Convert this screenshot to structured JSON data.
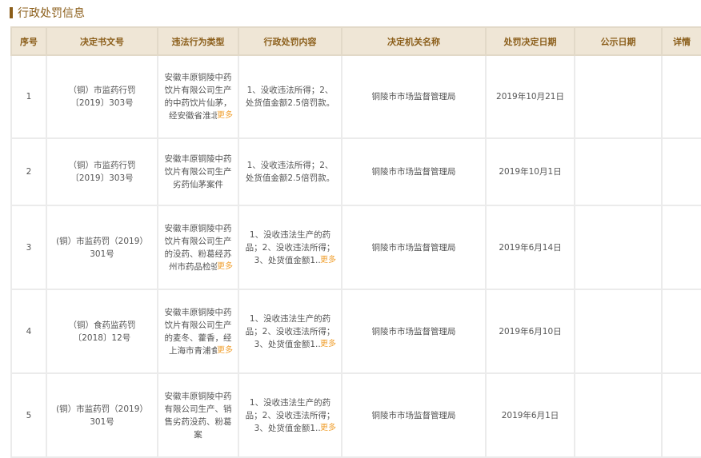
{
  "section": {
    "title": "行政处罚信息"
  },
  "table": {
    "headers": [
      "序号",
      "决定书文号",
      "违法行为类型",
      "行政处罚内容",
      "决定机关名称",
      "处罚决定日期",
      "公示日期",
      "详情"
    ],
    "more_label": "更多",
    "rows": [
      {
        "index": "1",
        "doc_no": "（铜）市监药行罚〔2019〕303号",
        "violation": "安徽丰原铜陵中药饮片有限公司生产的中药饮片仙茅，经安徽省淮北...",
        "has_violation_more": true,
        "content": "1、没收违法所得；2、处货值金额2.5倍罚款。",
        "has_content_more": false,
        "authority": "铜陵市市场监督管理局",
        "decision_date": "2019年10月21日",
        "publish_date": "",
        "detail": ""
      },
      {
        "index": "2",
        "doc_no": "（铜）市监药行罚〔2019〕303号",
        "violation": "安徽丰原铜陵中药饮片有限公司生产劣药仙茅案件",
        "has_violation_more": false,
        "content": "1、没收违法所得；2、处货值金额2.5倍罚款。",
        "has_content_more": false,
        "authority": "铜陵市市场监督管理局",
        "decision_date": "2019年10月1日",
        "publish_date": "",
        "detail": ""
      },
      {
        "index": "3",
        "doc_no": "(铜）市监药罚（2019）301号",
        "violation": "安徽丰原铜陵中药饮片有限公司生产的没药、粉葛经苏州市药品检验...",
        "has_violation_more": true,
        "content": "1、没收违法生产的药品；2、没收违法所得；3、处货值金额1....",
        "has_content_more": true,
        "authority": "铜陵市市场监督管理局",
        "decision_date": "2019年6月14日",
        "publish_date": "",
        "detail": ""
      },
      {
        "index": "4",
        "doc_no": "（铜）食药监药罚〔2018〕12号",
        "violation": "安徽丰原铜陵中药饮片有限公司生产的麦冬、藿香，经上海市青浦食...",
        "has_violation_more": true,
        "content": "1、没收违法生产的药品；2、没收违法所得；3、处货值金额1....",
        "has_content_more": true,
        "authority": "铜陵市市场监督管理局",
        "decision_date": "2019年6月10日",
        "publish_date": "",
        "detail": ""
      },
      {
        "index": "5",
        "doc_no": "(铜）市监药罚（2019）301号",
        "violation": "安徽丰原铜陵中药有限公司生产、销售劣药没药、粉葛案",
        "has_violation_more": false,
        "content": "1、没收违法生产的药品；2、没收违法所得；3、处货值金额1....",
        "has_content_more": true,
        "authority": "铜陵市市场监督管理局",
        "decision_date": "2019年6月1日",
        "publish_date": "",
        "detail": ""
      }
    ]
  }
}
